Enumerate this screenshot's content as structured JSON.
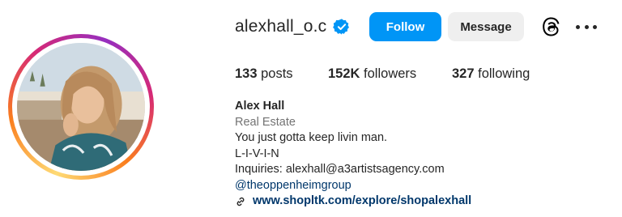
{
  "profile": {
    "username": "alexhall_o.c",
    "verified": true,
    "verified_color": "#0095f6",
    "avatar_icon": "profile-photo",
    "ring_gradient": [
      "#feda75",
      "#fa7e1e",
      "#d62976",
      "#962fbf"
    ]
  },
  "actions": {
    "follow_label": "Follow",
    "follow_color": "#0095f6",
    "message_label": "Message",
    "threads_icon": "threads-icon",
    "more_icon": "more-options-icon"
  },
  "stats": {
    "posts_count": "133",
    "posts_label": "posts",
    "followers_count": "152K",
    "followers_label": "followers",
    "following_count": "327",
    "following_label": "following"
  },
  "bio": {
    "name": "Alex Hall",
    "category": "Real Estate",
    "line1": "You just gotta keep livin man.",
    "line2": "L-I-V-I-N",
    "line3": "Inquiries: alexhall@a3artistsagency.com",
    "mention": "@theoppenheimgroup",
    "link": "www.shopltk.com/explore/shopalexhall",
    "link_icon": "link-icon"
  }
}
